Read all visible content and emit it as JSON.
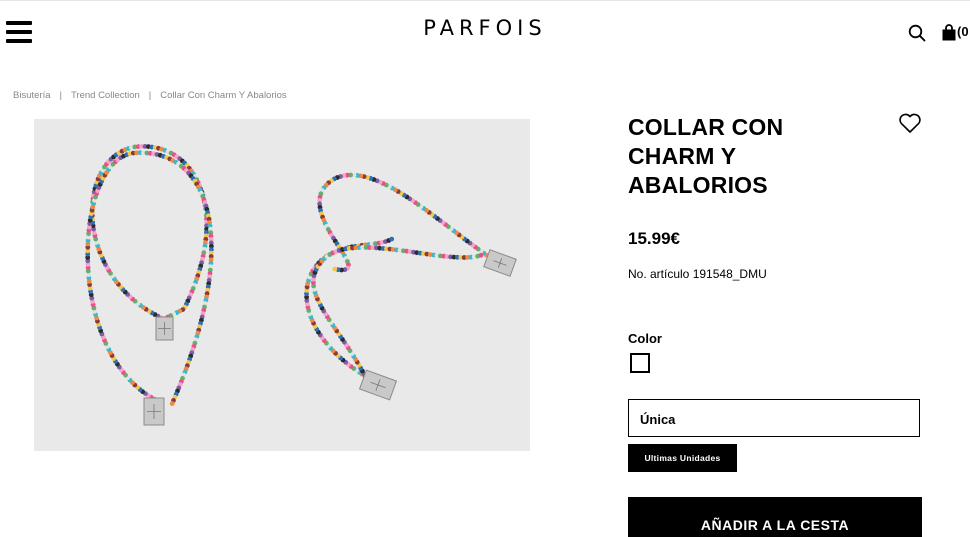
{
  "header": {
    "logo": "PARFOIS",
    "cart_count": "(0"
  },
  "breadcrumb": [
    "Bisutería",
    "Trend Collection",
    "Collar Con Charm Y Abalorios"
  ],
  "product": {
    "title_lines": [
      "COLLAR CON",
      "CHARM Y",
      "ABALORIOS"
    ],
    "price": "15.99€",
    "article_number": "No. artículo 191548_DMU",
    "color_label": "Color",
    "size_value": "Única",
    "stock_badge": "Ultimas Unidades",
    "add_to_cart": "AÑADIR A LA CESTA",
    "image_background": "#e9e9e9",
    "bead_colors": [
      "#e84f8b",
      "#3fb6c9",
      "#f2c94c",
      "#7b5ea7",
      "#5fb36b",
      "#f08a3c",
      "#2b6fb8",
      "#f4a6c4",
      "#e2e2e2",
      "#8b3a3a",
      "#2c2c2c"
    ]
  }
}
